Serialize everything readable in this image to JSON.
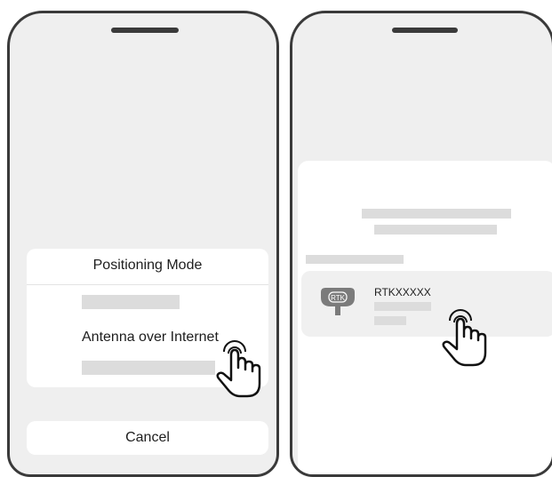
{
  "left_screen": {
    "sheet_title": "Positioning Mode",
    "option_label": "Antenna over Internet",
    "cancel_label": "Cancel"
  },
  "right_screen": {
    "device_name": "RTKXXXXX",
    "device_icon_label": "RTK"
  },
  "icons": [
    "tap-hand-icon",
    "rtk-antenna-icon"
  ]
}
